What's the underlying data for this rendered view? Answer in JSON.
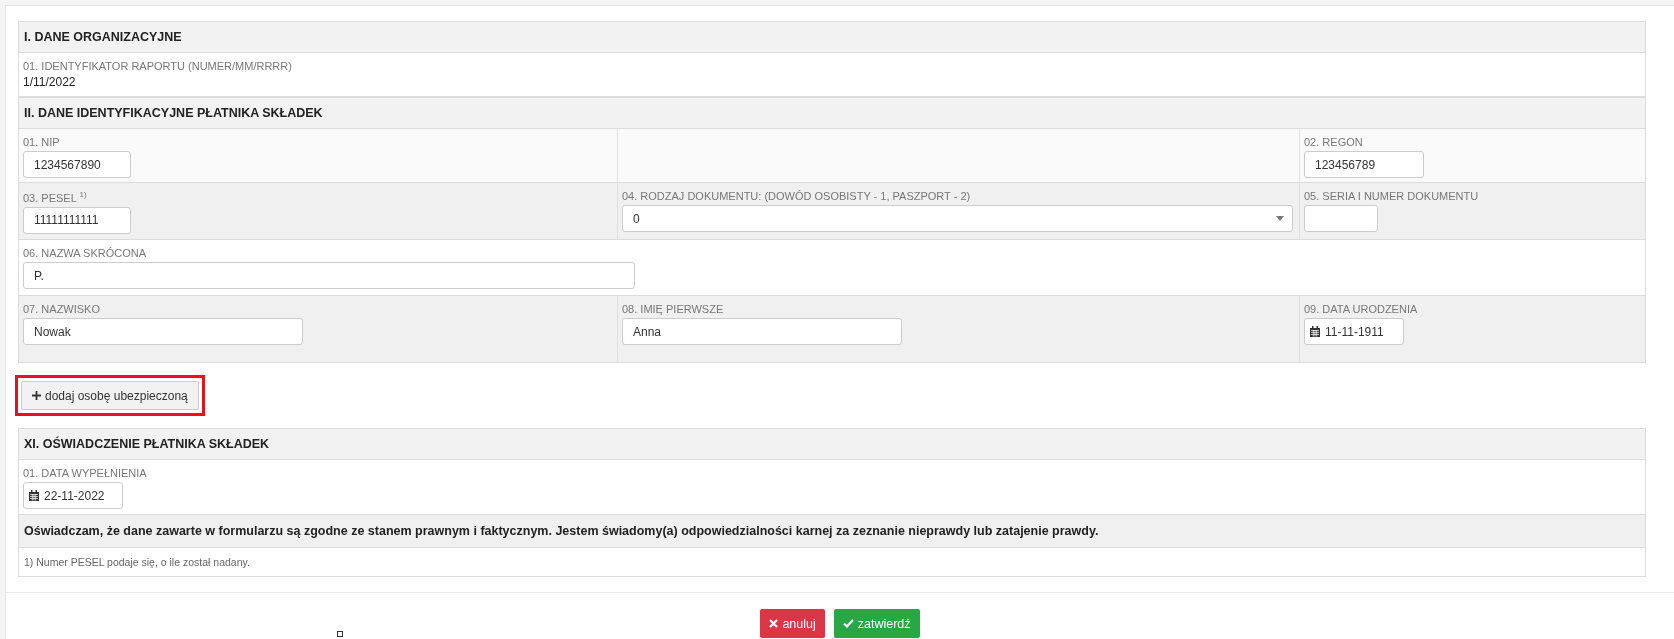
{
  "sections_top": [
    {
      "title": "I. DANE ORGANIZACYJNE",
      "rows": [
        {
          "cells": [
            {
              "kind": "text",
              "label": "01. IDENTYFIKATOR RAPORTU (NUMER/MM/RRRR)",
              "value": "1/11/2022"
            }
          ]
        }
      ]
    },
    {
      "title": "II. DANE IDENTYFIKACYJNE PŁATNIKA SKŁADEK",
      "rows": [
        {
          "cells": [
            {
              "kind": "input",
              "label": "01. NIP",
              "value": "1234567890"
            },
            {
              "kind": "empty"
            },
            {
              "kind": "input",
              "label": "02. REGON",
              "value": "123456789"
            }
          ]
        },
        {
          "cells": [
            {
              "kind": "input",
              "label": "03. PESEL $^{1)}$",
              "value": "11111111111"
            },
            {
              "kind": "select",
              "label": "04. RODZAJ DOKUMENTU: (DOWÓD OSOBISTY - 1, PASZPORT - 2)",
              "value": "0"
            },
            {
              "kind": "input",
              "label": "05. SERIA I NUMER DOKUMENTU"
            }
          ]
        },
        {
          "cells": [
            {
              "kind": "input",
              "label": "06. NAZWA SKRÓCONA",
              "value": "P."
            }
          ]
        },
        {
          "cells": [
            {
              "kind": "input",
              "label": "07. NAZWISKO",
              "value": "Nowak"
            },
            {
              "kind": "input",
              "label": "08. IMIĘ PIERWSZE",
              "value": "Anna"
            },
            {
              "kind": "date",
              "label": "09. DATA URODZENIA",
              "value": "11-11-1911"
            }
          ]
        }
      ]
    }
  ],
  "add_button": {
    "label": "dodaj osobę ubezpieczoną",
    "highlighted": true
  },
  "sections_bottom": [
    {
      "title": "XI. OŚWIADCZENIE PŁATNIKA SKŁADEK",
      "rows": [
        {
          "cells": [
            {
              "kind": "date",
              "label": "01. DATA WYPEŁNIENIA",
              "value": "22-11-2022"
            }
          ]
        },
        {
          "cells": [
            {
              "kind": "statement",
              "value": "Oświadczam, że dane zawarte w formularzu są zgodne ze stanem prawnym i faktycznym. Jestem świadomy(a) odpowiedzialności karnej za zeznanie nieprawdy lub zatajenie prawdy."
            }
          ]
        },
        {
          "cells": [
            {
              "kind": "footnote",
              "value": "1) Numer PESEL podaje się, o ile został nadany."
            }
          ]
        }
      ]
    }
  ],
  "actions": [
    {
      "kind": "cancel",
      "label": "anuluj"
    },
    {
      "kind": "confirm",
      "label": "zatwierdź"
    }
  ]
}
